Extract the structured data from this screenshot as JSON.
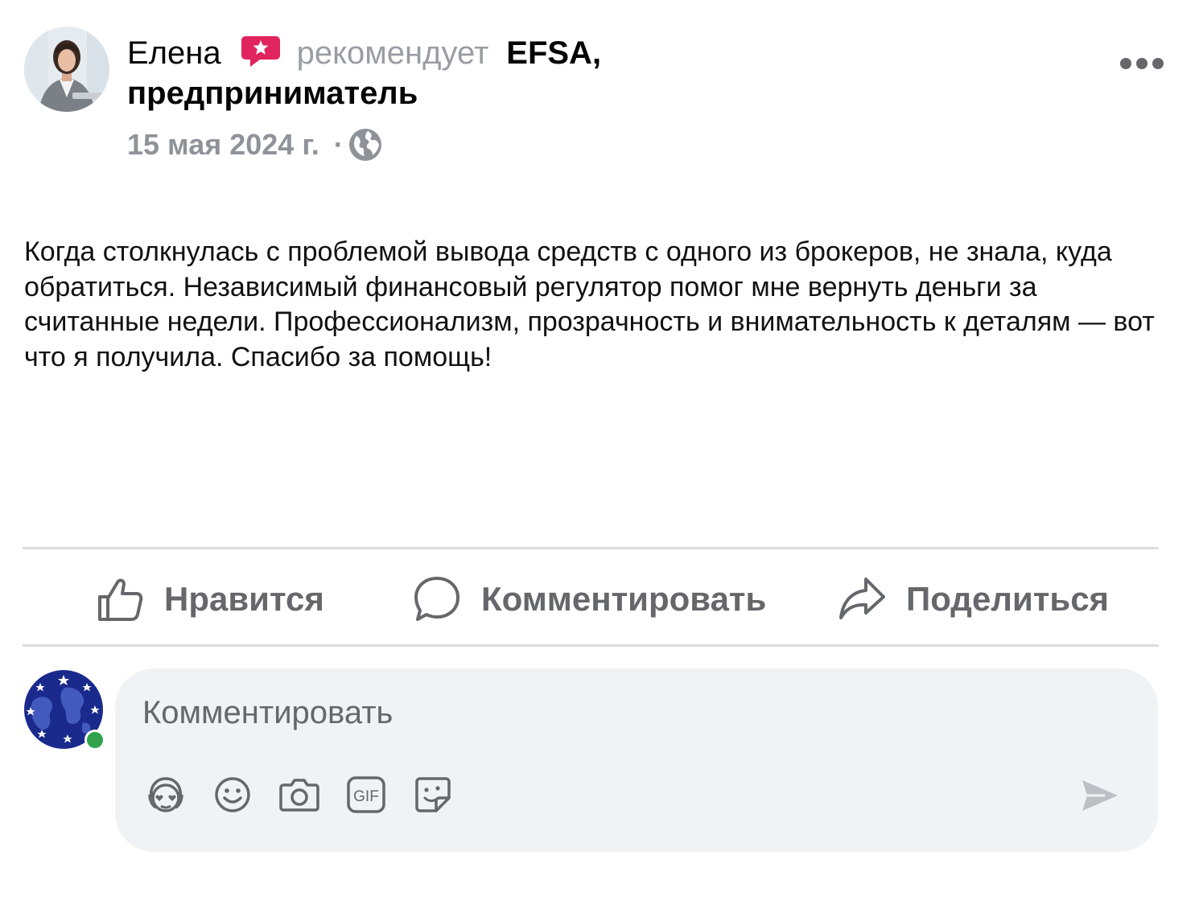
{
  "post": {
    "author_name": "Елена",
    "recommend_verb": "рекомендует",
    "page_name": "EFSA,",
    "page_name_line2": "предприниматель",
    "date": "15 мая 2024 г.",
    "separator": "·",
    "visibility_icon": "globe-icon",
    "more_icon": "more-options-icon",
    "text": "Когда столкнулась с проблемой вывода средств с одного из брокеров, не знала, куда обратиться. Независимый финансовый регулятор помог мне вернуть деньги за считанные недели. Профессионализм, прозрачность и внимательность к деталям — вот что я получила. Спасибо за помощь!"
  },
  "actions": {
    "like_label": "Нравится",
    "comment_label": "Комментировать",
    "share_label": "Поделиться"
  },
  "comment_box": {
    "placeholder": "Комментировать",
    "tools": [
      "avatar-sticker-icon",
      "emoji-icon",
      "camera-icon",
      "gif-icon",
      "sticker-icon"
    ],
    "send_icon": "send-icon"
  },
  "colors": {
    "recommend_badge": "#e0245e",
    "secondary_text": "#65676b",
    "divider": "#dadde1",
    "input_bg": "#f0f2f5",
    "online": "#31a24c",
    "user_avatar": "#1a2a8c"
  }
}
